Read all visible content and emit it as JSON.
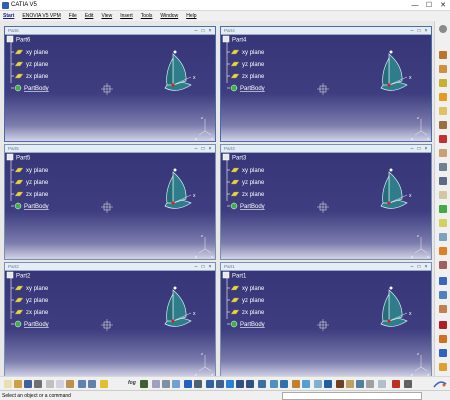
{
  "window": {
    "title": "CATIA V5",
    "minimize": "—",
    "maximize": "☐",
    "close": "✕"
  },
  "menu": [
    "Start",
    "ENOVIA V5 VPM",
    "File",
    "Edit",
    "View",
    "Insert",
    "Tools",
    "Window",
    "Help"
  ],
  "child_windows": [
    {
      "caption": "Part6",
      "part_name": "Part6",
      "active": true
    },
    {
      "caption": "Part4",
      "part_name": "Part4",
      "active": true
    },
    {
      "caption": "Part5",
      "part_name": "Part5",
      "active": false
    },
    {
      "caption": "Part3",
      "part_name": "Part3",
      "active": false
    },
    {
      "caption": "Part2",
      "part_name": "Part2",
      "active": false
    },
    {
      "caption": "Part1",
      "part_name": "Part1",
      "active": false
    }
  ],
  "tree": {
    "planes": [
      "xy plane",
      "yz plane",
      "zx plane"
    ],
    "body": "PartBody"
  },
  "axis_labels": {
    "x": "x",
    "y": "y",
    "z": "z"
  },
  "toolbar_text": {
    "fog": "fog"
  },
  "status": {
    "text": "Select an object or a command",
    "input_value": ""
  },
  "logo_text": "CATIA"
}
